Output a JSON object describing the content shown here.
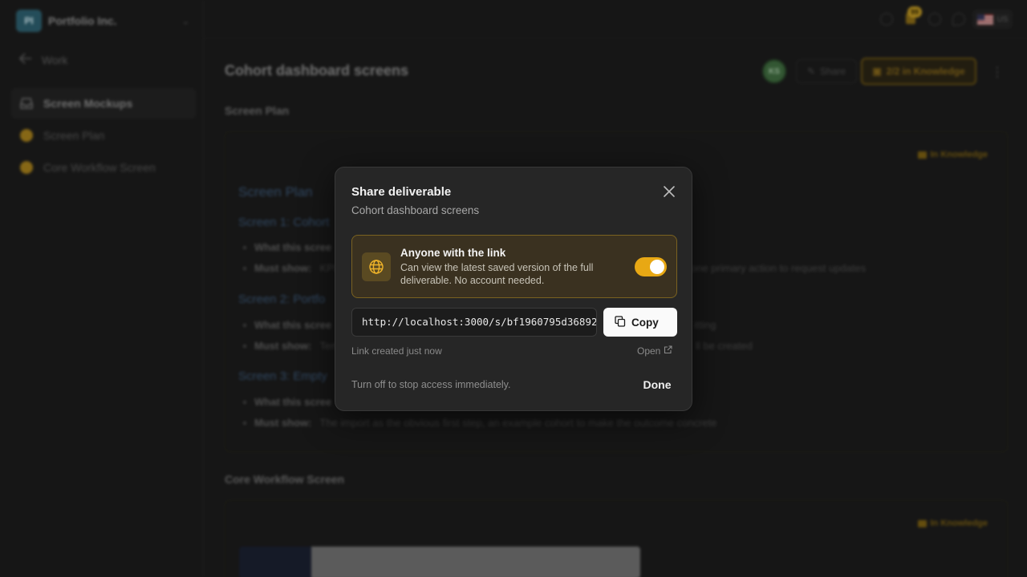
{
  "workspace": {
    "initials": "PI",
    "name": "Portfolio Inc."
  },
  "sidebar": {
    "back_label": "Work",
    "items": [
      {
        "label": "Screen Mockups",
        "icon": "inbox-icon",
        "active": true
      },
      {
        "label": "Screen Plan",
        "icon": "status-dot-icon"
      },
      {
        "label": "Core Workflow Screen",
        "icon": "status-dot-icon"
      }
    ]
  },
  "topbar": {
    "notification_count": "99",
    "language": "US"
  },
  "page": {
    "title": "Cohort dashboard screens",
    "user_initials": "KS",
    "share_label": "Share",
    "knowledge_label": "2/2 in Knowledge"
  },
  "sections": [
    {
      "heading": "Screen Plan",
      "badge": "In Knowledge",
      "doc": {
        "h1": "Screen Plan",
        "s1_heading": "Screen 1: Cohort",
        "s1_what": "What this scree",
        "s1_must_label": "Must show:",
        "s1_must_text": "KPI",
        "s1_tail": "one primary action to request updates",
        "s2_heading": "Screen 2: Portfo",
        "s2_what": "What this scree",
        "s2_what_tail": "itting",
        "s2_must_label": "Must show:",
        "s2_must_text": "Tem",
        "s2_must_tail": "ll be created",
        "s3_heading": "Screen 3: Empty",
        "s3_what": "What this scree",
        "s3_must_label": "Must show:",
        "s3_must_text": "The import as the obvious first step, an example cohort to make the outcome concrete"
      }
    },
    {
      "heading": "Core Workflow Screen",
      "badge": "In Knowledge"
    }
  ],
  "modal": {
    "title": "Share deliverable",
    "subtitle": "Cohort dashboard screens",
    "access_title": "Anyone with the link",
    "access_desc": "Can view the latest saved version of the full deliverable. No account needed.",
    "toggle_on": true,
    "url": "http://localhost:3000/s/bf1960795d36892",
    "copy_label": "Copy",
    "link_meta": "Link created just now",
    "open_label": "Open",
    "footer_note": "Turn off to stop access immediately.",
    "done_label": "Done"
  },
  "colors": {
    "accent": "#e8a814",
    "accent_border": "#7a6220",
    "modal_bg": "#262626"
  }
}
